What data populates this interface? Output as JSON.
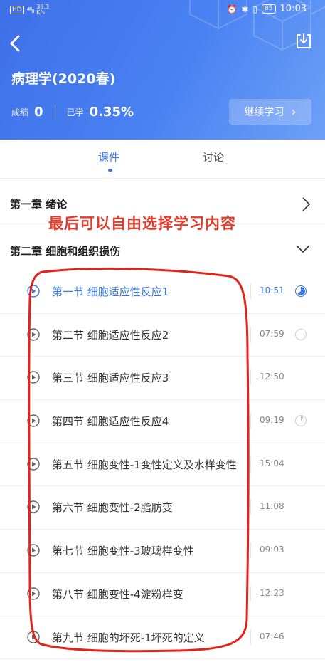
{
  "statusbar": {
    "network_badge": "HD",
    "signal": "⁴⁶ᵢₗₗ",
    "speed_value": "38.3",
    "speed_unit": "K/s",
    "icons": [
      "alarm-icon",
      "bluetooth-icon",
      "vibrate-icon"
    ],
    "battery": "85",
    "time": "10:03"
  },
  "header": {
    "title": "病理学(2020春)",
    "score_label": "成绩",
    "score_value": "0",
    "studied_label": "已学",
    "studied_value": "0.35%",
    "continue_label": "继续学习",
    "continue_arrow": "›"
  },
  "tabs": [
    {
      "label": "课件",
      "active": true
    },
    {
      "label": "讨论",
      "active": false
    }
  ],
  "chapters": [
    {
      "title": "第一章 绪论",
      "expanded": false
    },
    {
      "title": "第二章 细胞和组织损伤",
      "expanded": true
    }
  ],
  "annotation": "最后可以自由选择学习内容",
  "lessons": [
    {
      "title": "第一节 细胞适应性反应1",
      "duration": "10:51",
      "progress": 0.65,
      "active": true
    },
    {
      "title": "第二节 细胞适应性反应2",
      "duration": "07:59",
      "progress": 0,
      "active": false
    },
    {
      "title": "第三节 细胞适应性反应3",
      "duration": "12:50",
      "progress": null,
      "active": false
    },
    {
      "title": "第四节 细胞适应性反应4",
      "duration": "09:19",
      "progress": 0.1,
      "active": false
    },
    {
      "title": "第五节 细胞变性-1变性定义及水样变性",
      "duration": "15:04",
      "progress": null,
      "active": false
    },
    {
      "title": "第六节 细胞变性-2脂肪变",
      "duration": "11:08",
      "progress": null,
      "active": false
    },
    {
      "title": "第七节 细胞变性-3玻璃样变性",
      "duration": "09:03",
      "progress": null,
      "active": false
    },
    {
      "title": "第八节 细胞变性-4淀粉样变",
      "duration": "12:23",
      "progress": null,
      "active": false
    },
    {
      "title": "第九节 细胞的坏死-1坏死的定义",
      "duration": "07:46",
      "progress": null,
      "active": false
    }
  ],
  "colors": {
    "accent": "#3a78e8",
    "annotation": "#e23a2b",
    "header_start": "#3f6fe8",
    "header_end": "#6ea0f7"
  }
}
